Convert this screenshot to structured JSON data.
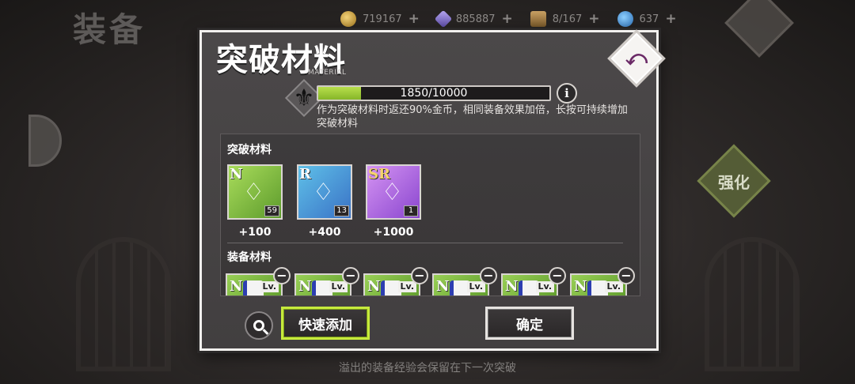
{
  "background": {
    "title": "装备",
    "currencies": [
      {
        "icon": "gold-coin-icon",
        "value": "719167"
      },
      {
        "icon": "crystal-icon",
        "value": "885887"
      },
      {
        "icon": "storage-box-icon",
        "value": "8/167"
      },
      {
        "icon": "gem-icon",
        "value": "637"
      }
    ],
    "plus": "+",
    "strength_label": "强化",
    "footer": "溢出的装备经验会保留在下一次突破"
  },
  "dialog": {
    "title": "突破材料",
    "close_glyph": "⤺",
    "material_tag": "MATERIAL",
    "progress": {
      "current": 1850,
      "max": 10000,
      "text": "1850/10000"
    },
    "info_glyph": "i",
    "description": "作为突破材料时返还90%金币，相同装备效果加倍，长按可持续增加突破材料",
    "breakthrough_section": {
      "label": "突破材料",
      "items": [
        {
          "rarity": "N",
          "count": "59",
          "value": "+100",
          "color": "green"
        },
        {
          "rarity": "R",
          "count": "13",
          "value": "+400",
          "color": "blue"
        },
        {
          "rarity": "SR",
          "count": "1",
          "value": "+1000",
          "color": "purple"
        }
      ]
    },
    "equipment_section": {
      "label": "装备材料",
      "items": [
        {
          "rarity": "N",
          "lv": "Lv."
        },
        {
          "rarity": "N",
          "lv": "Lv."
        },
        {
          "rarity": "N",
          "lv": "Lv."
        },
        {
          "rarity": "N",
          "lv": "Lv."
        },
        {
          "rarity": "N",
          "lv": "Lv."
        },
        {
          "rarity": "N",
          "lv": "Lv."
        }
      ],
      "remove_glyph": "−"
    },
    "quick_add_label": "快速添加",
    "confirm_label": "确定"
  }
}
